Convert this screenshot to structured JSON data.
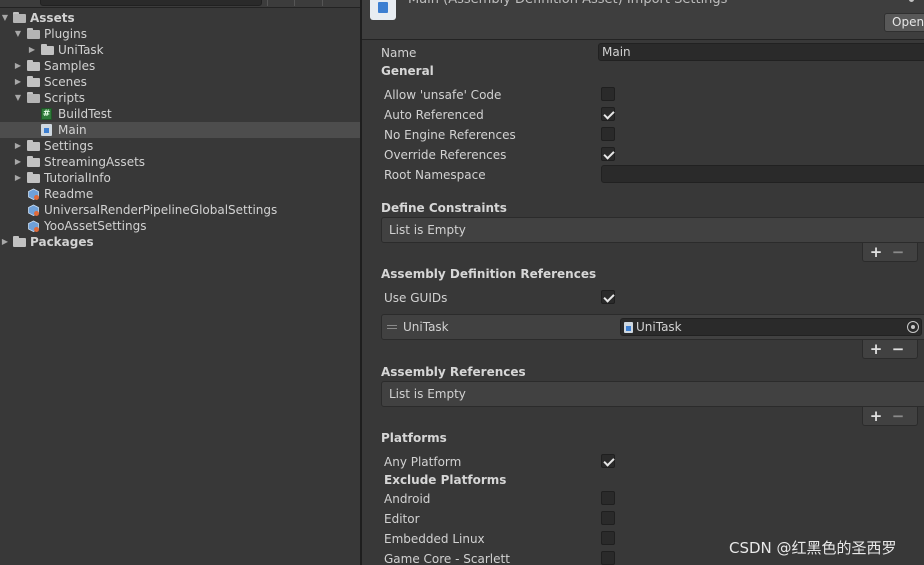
{
  "project": {
    "items": [
      {
        "label": "Assets",
        "icon": "folder-open-icon",
        "arrow": "▼",
        "bold": true
      },
      {
        "label": "Plugins",
        "icon": "folder-open-icon",
        "arrow": "▼"
      },
      {
        "label": "UniTask",
        "icon": "folder-icon",
        "arrow": "▶"
      },
      {
        "label": "Samples",
        "icon": "folder-icon",
        "arrow": "▶"
      },
      {
        "label": "Scenes",
        "icon": "folder-icon",
        "arrow": "▶"
      },
      {
        "label": "Scripts",
        "icon": "folder-open-icon",
        "arrow": "▼"
      },
      {
        "label": "BuildTest",
        "icon": "csharp-script-icon",
        "glyph": "#"
      },
      {
        "label": "Main",
        "icon": "assembly-definition-icon",
        "selected": true
      },
      {
        "label": "Settings",
        "icon": "folder-icon",
        "arrow": "▶"
      },
      {
        "label": "StreamingAssets",
        "icon": "folder-icon",
        "arrow": "▶"
      },
      {
        "label": "TutorialInfo",
        "icon": "folder-icon",
        "arrow": "▶"
      },
      {
        "label": "Readme",
        "icon": "scriptable-object-icon"
      },
      {
        "label": "UniversalRenderPipelineGlobalSettings",
        "icon": "scriptable-object-icon"
      },
      {
        "label": "YooAssetSettings",
        "icon": "scriptable-object-icon"
      },
      {
        "label": "Packages",
        "icon": "folder-icon",
        "arrow": "▶",
        "bold": true
      }
    ]
  },
  "inspector": {
    "header": {
      "title": "Main (Assembly Definition Asset) Import Settings",
      "open_label": "Open"
    },
    "name_label": "Name",
    "name_value": "Main",
    "general": {
      "title": "General",
      "allow_unsafe_label": "Allow 'unsafe' Code",
      "allow_unsafe": false,
      "auto_referenced_label": "Auto Referenced",
      "auto_referenced": true,
      "no_engine_refs_label": "No Engine References",
      "no_engine_refs": false,
      "override_refs_label": "Override References",
      "override_refs": true,
      "root_namespace_label": "Root Namespace",
      "root_namespace": ""
    },
    "define_constraints": {
      "title": "Define Constraints",
      "empty_text": "List is Empty"
    },
    "asmdef_refs": {
      "title": "Assembly Definition References",
      "use_guids_label": "Use GUIDs",
      "use_guids": true,
      "item_label": "UniTask",
      "item_value": "UniTask"
    },
    "assembly_refs": {
      "title": "Assembly References",
      "empty_text": "List is Empty"
    },
    "platforms": {
      "title": "Platforms",
      "any_platform_label": "Any Platform",
      "any_platform": true,
      "exclude_title": "Exclude Platforms",
      "list": [
        {
          "label": "Android",
          "checked": false
        },
        {
          "label": "Editor",
          "checked": false
        },
        {
          "label": "Embedded Linux",
          "checked": false
        },
        {
          "label": "Game Core - Scarlett",
          "checked": false
        }
      ]
    },
    "list_add": "+",
    "list_remove": "−"
  },
  "watermark": "CSDN @红黑色的圣西罗",
  "colors": {
    "background": "#383838",
    "selected_row": "#4d4d4d",
    "asmdef_blue": "#3d7fd1",
    "script_green": "#2f7a3a"
  }
}
